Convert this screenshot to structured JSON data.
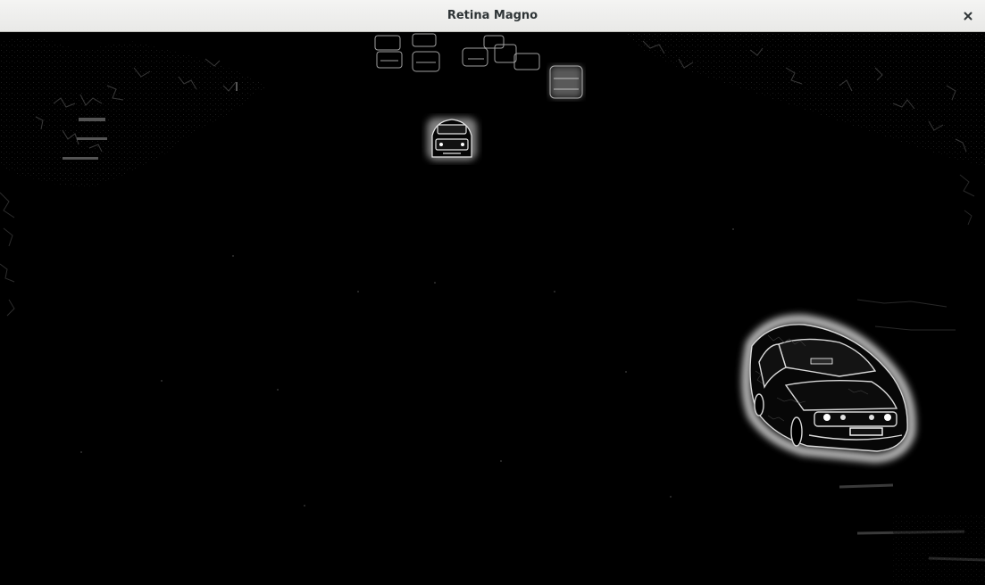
{
  "window": {
    "title": "Retina Magno"
  },
  "titlebar": {
    "close_icon": "close-icon"
  },
  "colors": {
    "titlebar_bg": "#ededeb",
    "title_text": "#2e3436",
    "viewport_bg": "#000000",
    "edge_highlight": "#ffffff"
  }
}
